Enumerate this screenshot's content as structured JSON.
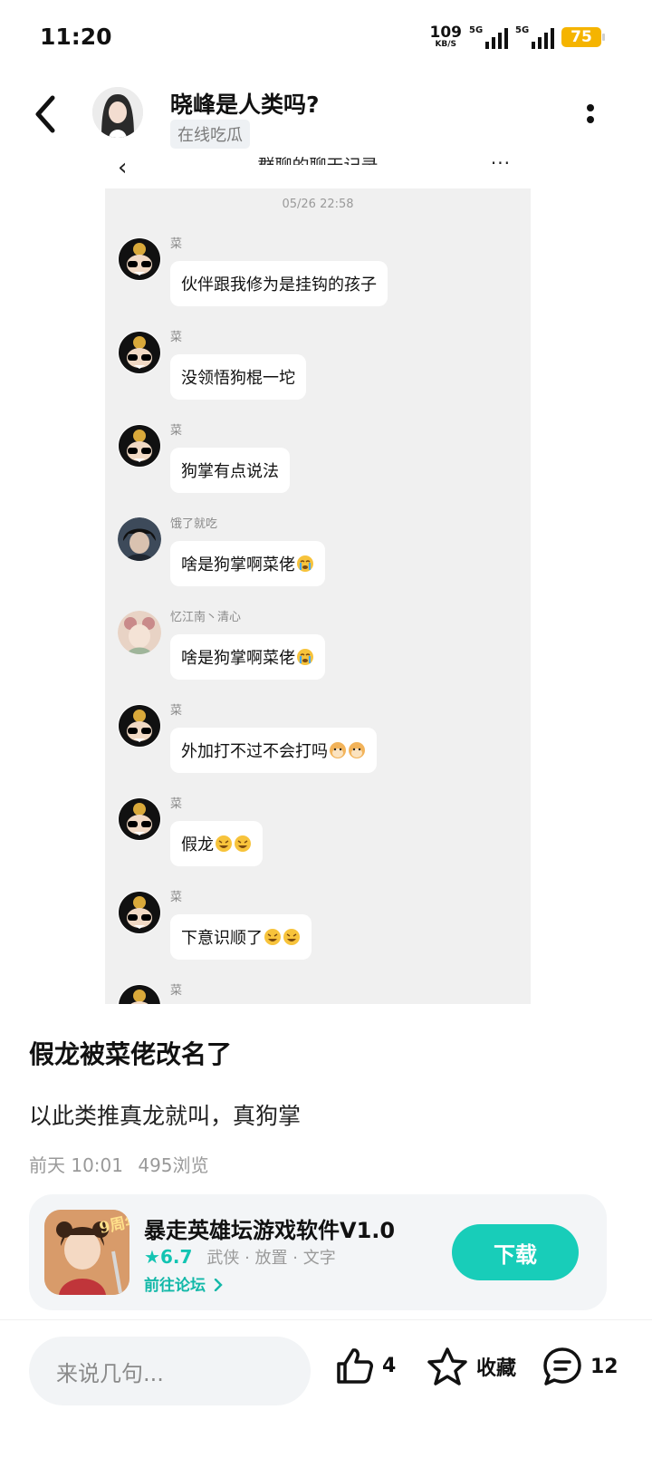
{
  "status_bar": {
    "time": "11:20",
    "net_speed": "109",
    "net_unit": "KB/S",
    "signal1_tag": "5G",
    "signal2_tag": "5G",
    "battery": "75"
  },
  "header": {
    "title": "晓峰是人类吗?",
    "tag": "在线吃瓜"
  },
  "screenshot": {
    "title": "群聊的聊天记录",
    "date": "05/26 22:58",
    "messages": [
      {
        "name": "菜",
        "text": "伙伴跟我修为是挂钩的孩子",
        "emoji": ""
      },
      {
        "name": "菜",
        "text": "没领悟狗棍一坨",
        "emoji": ""
      },
      {
        "name": "菜",
        "text": "狗掌有点说法",
        "emoji": ""
      },
      {
        "name": "饿了就吃",
        "text": "啥是狗掌啊菜佬",
        "emoji": "crying-emoji"
      },
      {
        "name": "忆江南丶清心",
        "text": "啥是狗掌啊菜佬",
        "emoji": "crying-emoji"
      },
      {
        "name": "菜",
        "text": "外加打不过不会打吗",
        "emoji": "doge-emoji x2"
      },
      {
        "name": "菜",
        "text": "假龙",
        "emoji": "grin-emoji x2"
      },
      {
        "name": "菜",
        "text": "下意识顺了",
        "emoji": "grin-emoji x2"
      },
      {
        "name": "菜",
        "text": "",
        "emoji": ""
      }
    ]
  },
  "post": {
    "title": "假龙被菜佬改名了",
    "body": "以此类推真龙就叫，真狗掌",
    "time": "前天 10:01",
    "views": "495浏览"
  },
  "app_card": {
    "name": "暴走英雄坛游戏软件V1.0",
    "score": "6.7",
    "tags": "武侠 · 放置 · 文字",
    "link": "前往论坛",
    "download": "下载",
    "accent": "#18cdb9"
  },
  "bottom_bar": {
    "comment_placeholder": "来说几句...",
    "like_count": "4",
    "favorite_label": "收藏",
    "comment_count": "12"
  }
}
